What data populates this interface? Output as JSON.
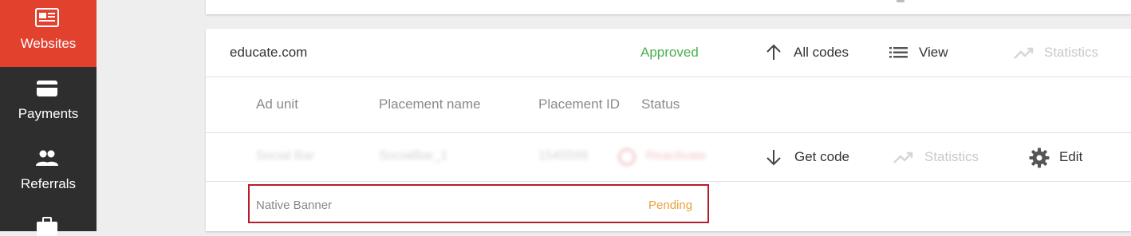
{
  "sidebar": {
    "items": [
      {
        "label": "Websites",
        "icon": "websites-icon",
        "active": true
      },
      {
        "label": "Payments",
        "icon": "payment-card-icon",
        "active": false
      },
      {
        "label": "Referrals",
        "icon": "people-icon",
        "active": false
      },
      {
        "label": "",
        "icon": "briefcase-icon",
        "active": false
      }
    ]
  },
  "site": {
    "name": "educate.com",
    "status": "Approved",
    "actions": {
      "all_codes": "All codes",
      "view": "View",
      "statistics": "Statistics"
    }
  },
  "table": {
    "headers": [
      "Ad unit",
      "Placement name",
      "Placement ID",
      "Status"
    ],
    "blurred_row": {
      "ad_unit": "Social Bar",
      "placement_name": "SocialBar_1",
      "placement_id": "1545599",
      "status": "Reactivate",
      "actions": {
        "get_code": "Get code",
        "statistics": "Statistics",
        "edit": "Edit"
      }
    },
    "native_row": {
      "ad_unit": "Native Banner",
      "status": "Pending"
    }
  },
  "colors": {
    "sidebar_bg": "#2e2e2e",
    "active_accent": "#e2412e",
    "approved": "#4caf50",
    "pending": "#e8a23b",
    "highlight_border": "#b71c2c"
  }
}
